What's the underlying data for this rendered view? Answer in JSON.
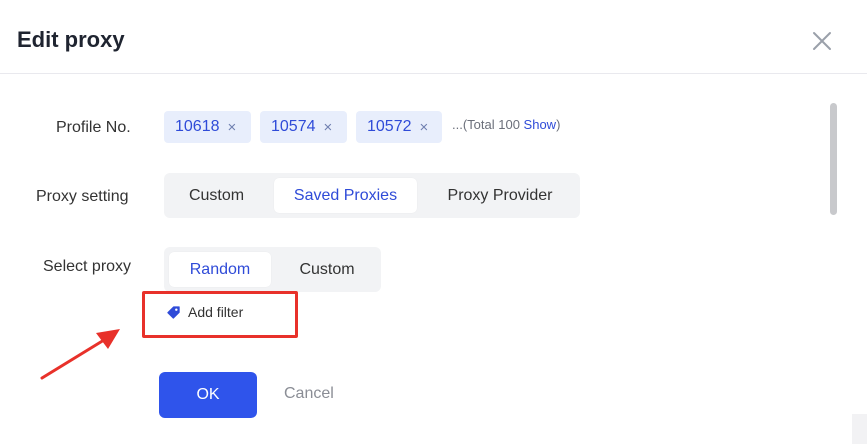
{
  "dialog": {
    "title": "Edit proxy",
    "close_icon": "close-icon"
  },
  "profile": {
    "label": "Profile No.",
    "tags": [
      {
        "value": "10618",
        "remove": "×"
      },
      {
        "value": "10574",
        "remove": "×"
      },
      {
        "value": "10572",
        "remove": "×"
      }
    ],
    "total_prefix": "...(Total 100 ",
    "show_label": "Show",
    "total_suffix": ")"
  },
  "proxy_setting": {
    "label": "Proxy setting",
    "options": [
      "Custom",
      "Saved Proxies",
      "Proxy Provider"
    ],
    "selected": "Saved Proxies"
  },
  "select_proxy": {
    "label": "Select proxy",
    "options": [
      "Random",
      "Custom"
    ],
    "selected": "Random"
  },
  "filter": {
    "label": "Add filter",
    "icon": "tag-icon"
  },
  "footer": {
    "ok_label": "OK",
    "cancel_label": "Cancel"
  },
  "colors": {
    "accent": "#2f54eb",
    "link": "#2f4bd8",
    "highlight": "#e8312a"
  }
}
